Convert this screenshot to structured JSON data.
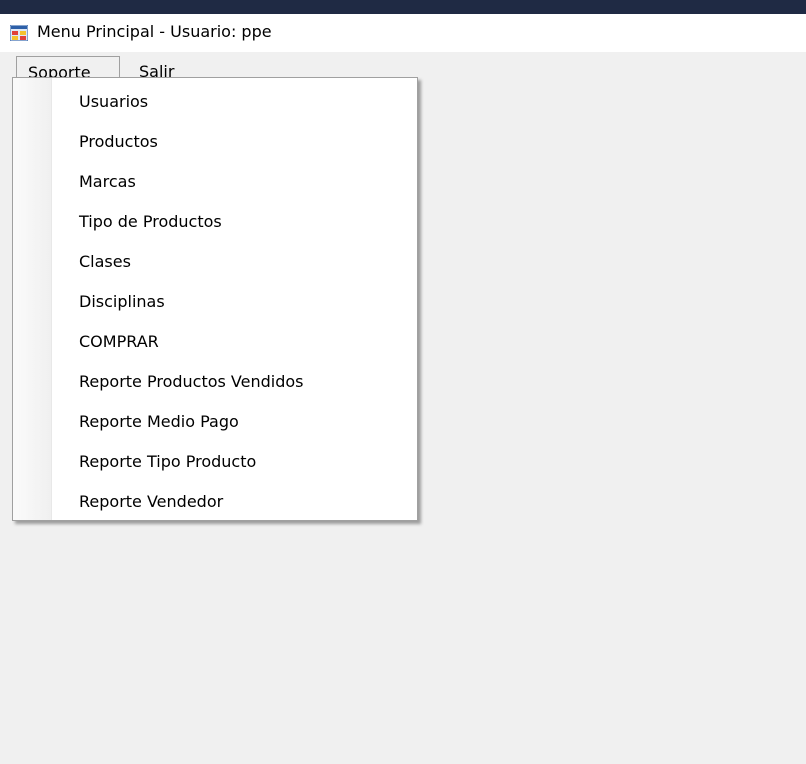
{
  "window": {
    "title": "Menu Principal - Usuario: ppe"
  },
  "icons": {
    "app": "windows-form-icon"
  },
  "menubar": {
    "items": [
      {
        "label": "Soporte"
      },
      {
        "label": "Salir"
      }
    ]
  },
  "dropdown": {
    "items": [
      {
        "label": "Usuarios"
      },
      {
        "label": "Productos"
      },
      {
        "label": "Marcas"
      },
      {
        "label": "Tipo de Productos"
      },
      {
        "label": "Clases"
      },
      {
        "label": "Disciplinas"
      },
      {
        "label": "COMPRAR"
      },
      {
        "label": "Reporte Productos Vendidos"
      },
      {
        "label": "Reporte Medio Pago"
      },
      {
        "label": "Reporte Tipo Producto"
      },
      {
        "label": "Reporte Vendedor"
      }
    ]
  }
}
